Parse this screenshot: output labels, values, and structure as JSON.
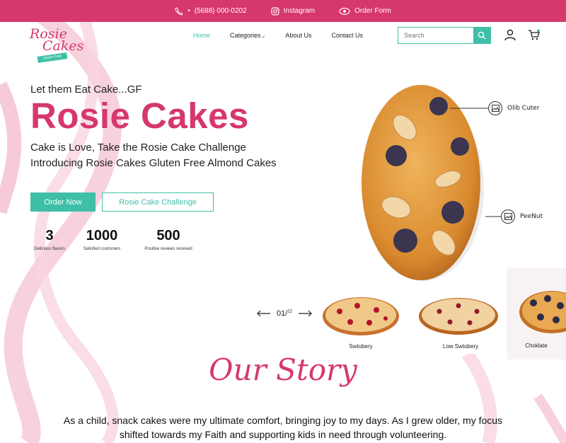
{
  "topbar": {
    "phone": "(5688) 000-0202",
    "instagram": "Instagram",
    "order_form": "Order Form"
  },
  "logo": {
    "line1": "Rosie",
    "line2": "Cakes",
    "banner": "Gluten Free"
  },
  "nav": {
    "home": "Home",
    "categories": "Categories",
    "about": "About Us",
    "contact": "Contact Us"
  },
  "search": {
    "placeholder": "Search"
  },
  "hero": {
    "tagline": "Let them Eat Cake...GF",
    "title": "Rosie Cakes",
    "subtitle_1": "Cake is Love, Take the Rosie Cake Challenge",
    "subtitle_2": "Introducing Rosie Cakes Gluten Free Almond Cakes",
    "order_button": "Order Now",
    "challenge_button": "Rosie Cake Challenge"
  },
  "stats": [
    {
      "value": "3",
      "label": "Delicious flavors"
    },
    {
      "value": "1000",
      "label": "Satisfied customers"
    },
    {
      "value": "500",
      "label": "Positive reviews received"
    }
  ],
  "callouts": {
    "top": "Olib Cuter",
    "bottom": "PeeNut"
  },
  "slider": {
    "current": "01",
    "total": "12"
  },
  "thumbnails": [
    {
      "name": "Swtobery"
    },
    {
      "name": "Low Swtobery"
    },
    {
      "name": "Choklate"
    }
  ],
  "story": {
    "title": "Our Story",
    "text_line_1": "As a child, snack cakes were my ultimate comfort, bringing joy to my days. As I grew older, my focus",
    "text_line_2": "shifted towards my Faith and supporting kids in need through volunteering."
  },
  "colors": {
    "brand_pink": "#d6386b",
    "accent_teal": "#3fbfa8"
  }
}
